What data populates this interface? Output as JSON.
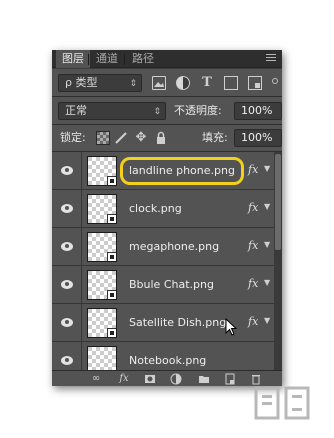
{
  "tabs": [
    {
      "label": "图层",
      "active": true
    },
    {
      "label": "通道",
      "active": false
    },
    {
      "label": "路径",
      "active": false
    }
  ],
  "filter": {
    "kind_label": "ρ 类型",
    "icons": [
      "image-filter-icon",
      "adjustment-filter-icon",
      "type-filter-icon",
      "shape-filter-icon",
      "smart-object-filter-icon"
    ],
    "type_icon_glyph": "T"
  },
  "blend": {
    "mode": "正常",
    "opacity_label": "不透明度:",
    "opacity_value": "100%"
  },
  "lock": {
    "label": "锁定:",
    "fill_label": "填充:",
    "fill_value": "100%",
    "icons": [
      "lock-transparent-pixels-icon",
      "lock-image-pixels-icon",
      "lock-position-icon",
      "lock-all-icon"
    ]
  },
  "layers": [
    {
      "name": "landline phone.png",
      "fx": "fx",
      "highlighted": true
    },
    {
      "name": "clock.png",
      "fx": "fx"
    },
    {
      "name": "megaphone.png",
      "fx": "fx"
    },
    {
      "name": "Bbule Chat.png",
      "fx": "fx"
    },
    {
      "name": "Satellite Dish.png",
      "fx": "fx"
    },
    {
      "name": "Notebook.png",
      "fx": ""
    }
  ],
  "footer_icons": [
    "link-layers-icon",
    "fx-icon",
    "mask-icon",
    "adjustment-layer-icon",
    "group-folder-icon",
    "new-layer-icon",
    "trash-icon"
  ],
  "footer_fx": "fx",
  "colors": {
    "panel_bg": "#535353",
    "highlight": "#f3d01e"
  }
}
